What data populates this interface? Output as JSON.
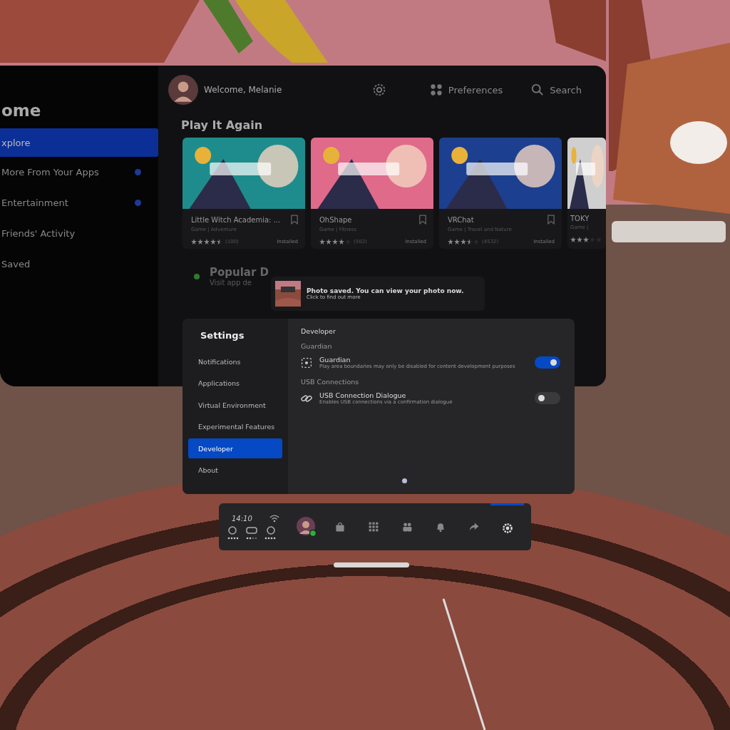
{
  "home": {
    "title": "ome",
    "greeting": "Welcome, Melanie",
    "header_actions": [
      {
        "kind": "settings"
      },
      {
        "kind": "preferences",
        "label": "Preferences"
      },
      {
        "kind": "search",
        "label": "Search"
      }
    ],
    "nav": [
      {
        "label": "xplore",
        "selected": true,
        "dot": false
      },
      {
        "label": "More From Your Apps",
        "selected": false,
        "dot": true
      },
      {
        "label": "Entertainment",
        "selected": false,
        "dot": true
      },
      {
        "label": "Friends' Activity",
        "selected": false,
        "dot": false
      },
      {
        "label": "Saved",
        "selected": false,
        "dot": false
      }
    ],
    "section_title": "Play It Again",
    "apps": [
      {
        "title": "Little Witch Academia: ...",
        "genre": "Game | Adventure",
        "stars": 4.5,
        "reviews": "(100)",
        "status": "Installed"
      },
      {
        "title": "OhShape",
        "genre": "Game | Fitness",
        "stars": 4,
        "reviews": "(502)",
        "status": "Installed"
      },
      {
        "title": "VRChat",
        "genre": "Game | Travel and Nature",
        "stars": 3.5,
        "reviews": "(4532)",
        "status": "Installed"
      },
      {
        "title": "TOKY",
        "genre": "Game |",
        "stars": 3
      }
    ],
    "popular": {
      "title": "Popular D",
      "subtitle": "Visit app de"
    }
  },
  "toast": {
    "title": "Photo saved. You can view your photo now.",
    "subtitle": "Click to find out more"
  },
  "settings": {
    "title": "Settings",
    "nav": [
      {
        "label": "Notifications",
        "selected": false
      },
      {
        "label": "Applications",
        "selected": false
      },
      {
        "label": "Virtual Environment",
        "selected": false
      },
      {
        "label": "Experimental Features",
        "selected": false
      },
      {
        "label": "Developer",
        "selected": true
      },
      {
        "label": "About",
        "selected": false
      }
    ],
    "page_title": "Developer",
    "sections": [
      {
        "heading": "Guardian",
        "items": [
          {
            "kind": "guardian",
            "title": "Guardian",
            "description": "Play area boundaries may only be disabled for content development purposes",
            "on": true
          }
        ]
      },
      {
        "heading": "USB Connections",
        "items": [
          {
            "kind": "usb",
            "title": "USB Connection Dialogue",
            "description": "Enables USB connections via a confirmation dialogue",
            "on": false
          }
        ]
      }
    ]
  },
  "taskbar": {
    "time": "14:10",
    "items": [
      {
        "kind": "avatar",
        "selected": false
      },
      {
        "kind": "store",
        "selected": false
      },
      {
        "kind": "apps",
        "selected": false
      },
      {
        "kind": "people",
        "selected": false
      },
      {
        "kind": "bell",
        "selected": false
      },
      {
        "kind": "share",
        "selected": false
      },
      {
        "kind": "settings",
        "selected": true
      }
    ]
  }
}
